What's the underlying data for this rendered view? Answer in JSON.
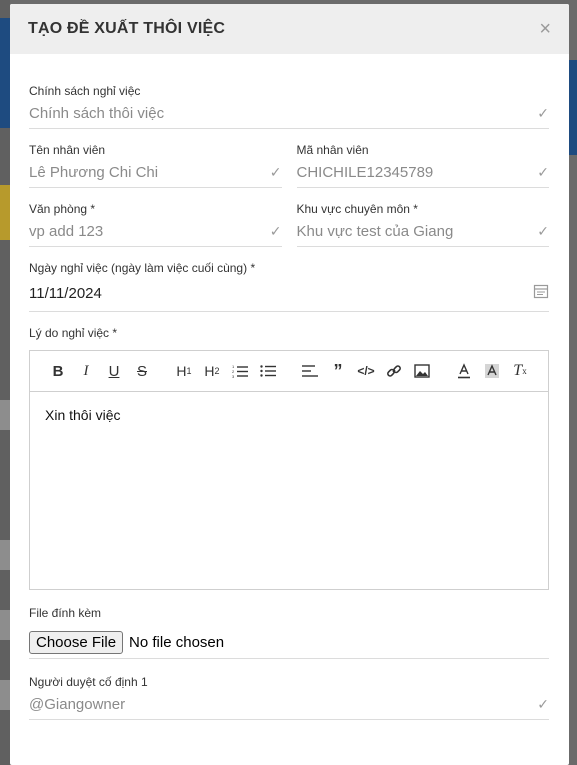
{
  "modal": {
    "title": "TẠO ĐỀ XUẤT THÔI VIỆC",
    "close_symbol": "×"
  },
  "fields": {
    "policy": {
      "label": "Chính sách nghỉ việc",
      "value": "Chính sách thôi việc"
    },
    "employee_name": {
      "label": "Tên nhân viên",
      "value": "Lê Phương Chi Chi"
    },
    "employee_code": {
      "label": "Mã nhân viên",
      "value": "CHICHILE12345789"
    },
    "office": {
      "label": "Văn phòng *",
      "value": "vp add 123"
    },
    "area": {
      "label": "Khu vực chuyên môn *",
      "value": "Khu vực test của Giang"
    },
    "leave_date": {
      "label": "Ngày nghỉ việc (ngày làm việc cuối cùng) *",
      "value": "11/11/2024"
    },
    "reason": {
      "label": "Lý do nghỉ việc *",
      "content": "Xin thôi việc"
    },
    "attachment": {
      "label": "File đính kèm",
      "button_label": "Choose File",
      "status": "No file chosen"
    },
    "approver": {
      "label": "Người duyệt cố định 1",
      "value": "@Giangowner"
    }
  },
  "check_symbol": "✓",
  "toolbar": [
    "bold",
    "italic",
    "underline",
    "strikethrough",
    "heading-1",
    "heading-2",
    "ordered-list",
    "bullet-list",
    "align",
    "blockquote",
    "code",
    "link",
    "image",
    "text-color",
    "background-color",
    "clear-format"
  ]
}
